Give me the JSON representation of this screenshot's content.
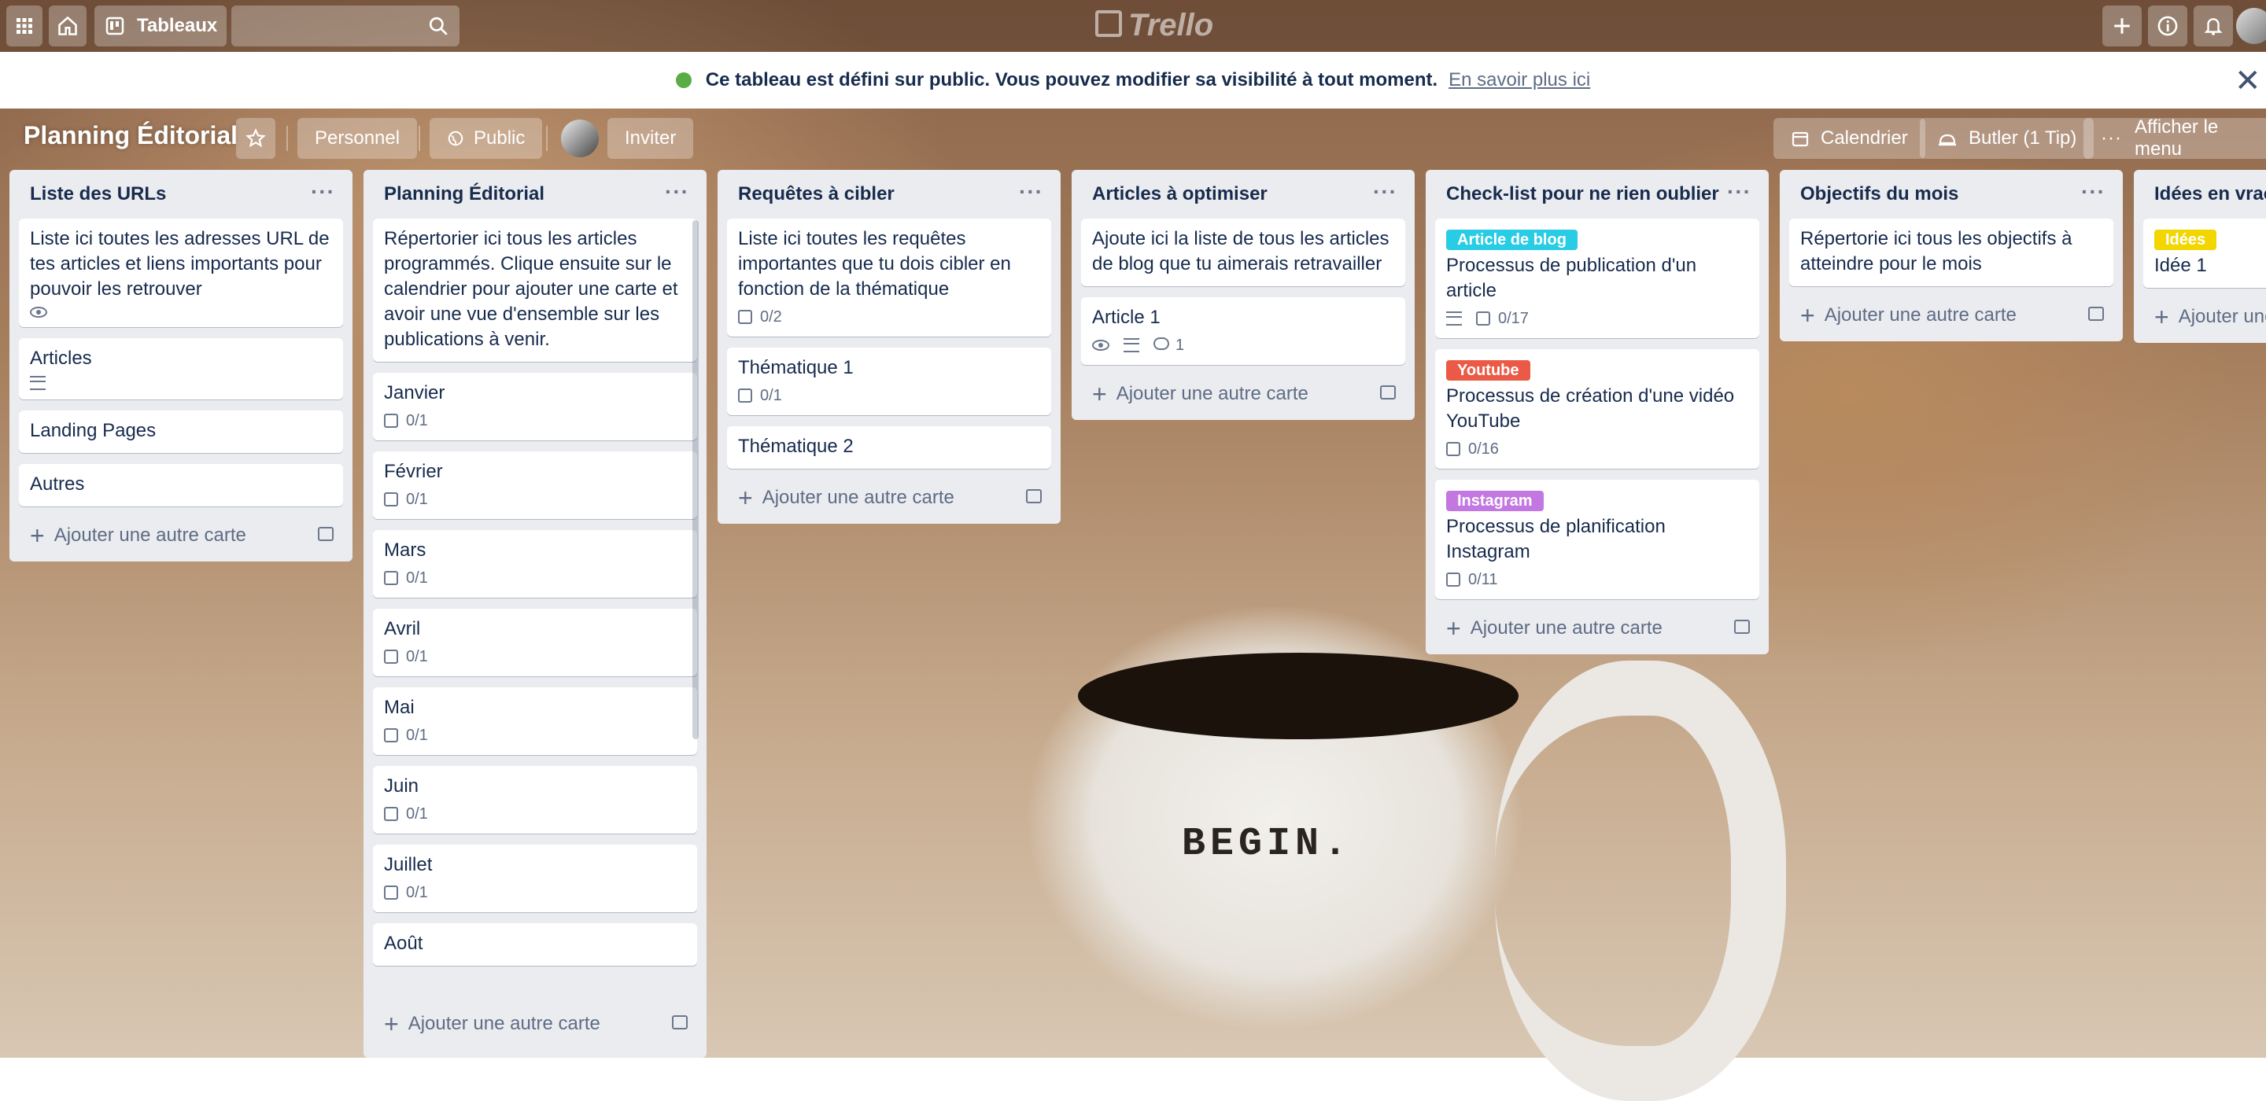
{
  "topbar": {
    "boards_label": "Tableaux",
    "logo_text": "Trello"
  },
  "banner": {
    "message": "Ce tableau est défini sur public. Vous pouvez modifier sa visibilité à tout moment.",
    "link": "En savoir plus ici"
  },
  "board": {
    "title": "Planning Éditorial",
    "team_label": "Personnel",
    "visibility_label": "Public",
    "invite_label": "Inviter",
    "calendar_label": "Calendrier",
    "butler_label": "Butler (1 Tip)",
    "menu_label": "Afficher le menu"
  },
  "add_card_label": "Ajouter une autre carte",
  "lists": [
    {
      "title": "Liste des URLs",
      "cards": [
        {
          "text": "Liste ici toutes les adresses URL de tes articles et liens importants pour pouvoir les retrouver",
          "watch": true
        },
        {
          "text": "Articles",
          "desc": true
        },
        {
          "text": "Landing Pages"
        },
        {
          "text": "Autres"
        }
      ]
    },
    {
      "title": "Planning Éditorial",
      "cards": [
        {
          "text": "Répertorier ici tous les articles programmés. Clique ensuite sur le calendrier pour ajouter une carte et avoir une vue d'ensemble sur les publications à venir."
        },
        {
          "text": "Janvier",
          "checklist": "0/1"
        },
        {
          "text": "Février",
          "checklist": "0/1"
        },
        {
          "text": "Mars",
          "checklist": "0/1"
        },
        {
          "text": "Avril",
          "checklist": "0/1"
        },
        {
          "text": "Mai",
          "checklist": "0/1"
        },
        {
          "text": "Juin",
          "checklist": "0/1"
        },
        {
          "text": "Juillet",
          "checklist": "0/1"
        },
        {
          "text": "Août"
        }
      ]
    },
    {
      "title": "Requêtes à cibler",
      "cards": [
        {
          "text": "Liste ici toutes les requêtes importantes que tu dois cibler en fonction de la thématique",
          "checklist": "0/2"
        },
        {
          "text": "Thématique 1",
          "checklist": "0/1"
        },
        {
          "text": "Thématique 2"
        }
      ]
    },
    {
      "title": "Articles à optimiser",
      "cards": [
        {
          "text": "Ajoute ici la liste de tous les articles de blog que tu aimerais retravailler"
        },
        {
          "text": "Article 1",
          "watch": true,
          "desc": true,
          "comments": "1"
        }
      ]
    },
    {
      "title": "Check-list pour ne rien oublier",
      "cards": [
        {
          "label": "Article de blog",
          "label_color": "#29cce5",
          "text": "Processus de publication d'un article",
          "desc": true,
          "checklist": "0/17"
        },
        {
          "label": "Youtube",
          "label_color": "#eb5a46",
          "text": "Processus de création d'une vidéo YouTube",
          "checklist": "0/16"
        },
        {
          "label": "Instagram",
          "label_color": "#c377e0",
          "text": "Processus de planification Instagram",
          "checklist": "0/11"
        }
      ]
    },
    {
      "title": "Objectifs du mois",
      "cards": [
        {
          "text": "Répertorie ici tous les objectifs à atteindre pour le mois"
        }
      ]
    },
    {
      "title": "Idées en vrac",
      "cards": [
        {
          "label": "Idées",
          "label_color": "#f2d600",
          "text": "Idée 1"
        }
      ]
    }
  ],
  "background_text": "BEGIN.",
  "colors": {
    "accent": "#0079bf",
    "list_bg": "#ebecf0",
    "text": "#172b4d",
    "banner_icon": "#5aac44"
  }
}
